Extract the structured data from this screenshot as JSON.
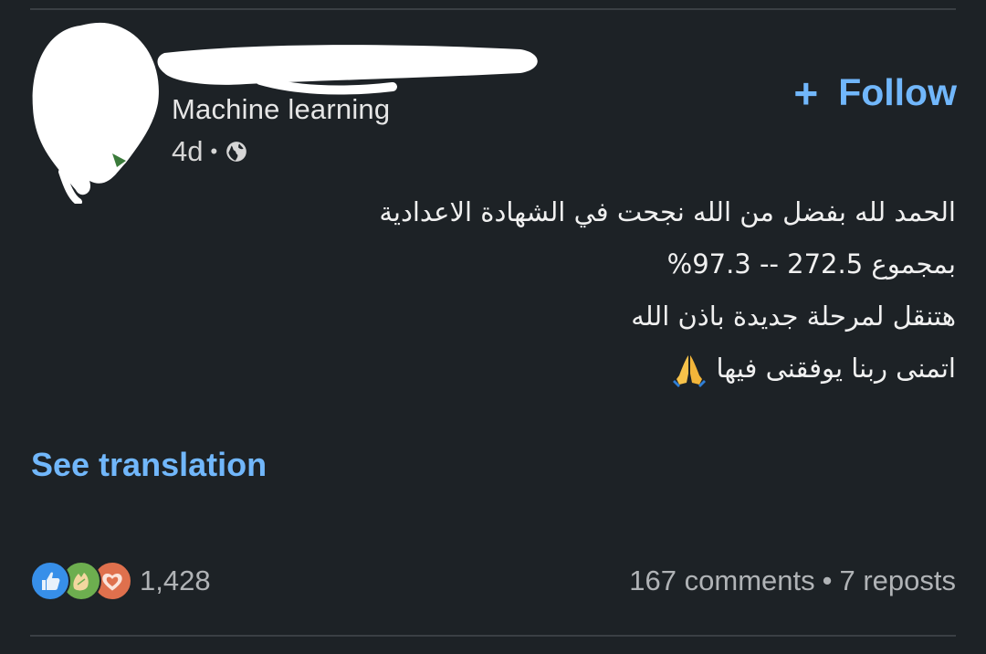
{
  "post": {
    "author": {
      "headline": "Machine learning",
      "time_ago": "4d",
      "separator": "•",
      "visibility_icon": "globe-icon"
    },
    "follow": {
      "icon": "plus-icon",
      "plus": "+",
      "label": "Follow"
    },
    "body_lines": [
      "الحمد لله بفضل من الله نجحت في الشهادة الاعدادية",
      "بمجموع 272.5  -- 97.3%",
      "هتنقل لمرحلة جديدة باذن الله",
      "اتمنى ربنا يوفقنى فيها"
    ],
    "body_emoji": "folded-hands-emoji",
    "see_translation": "See translation",
    "reactions": {
      "icons": [
        "like-icon",
        "celebrate-icon",
        "love-icon"
      ],
      "count": "1,428"
    },
    "engagement": {
      "comments": "167 comments",
      "separator": "•",
      "reposts": "7 reposts"
    }
  },
  "colors": {
    "background": "#1d2226",
    "accent_link": "#71b7fb",
    "like": "#378fe9",
    "celebrate": "#6dae4f",
    "love": "#df704d"
  }
}
